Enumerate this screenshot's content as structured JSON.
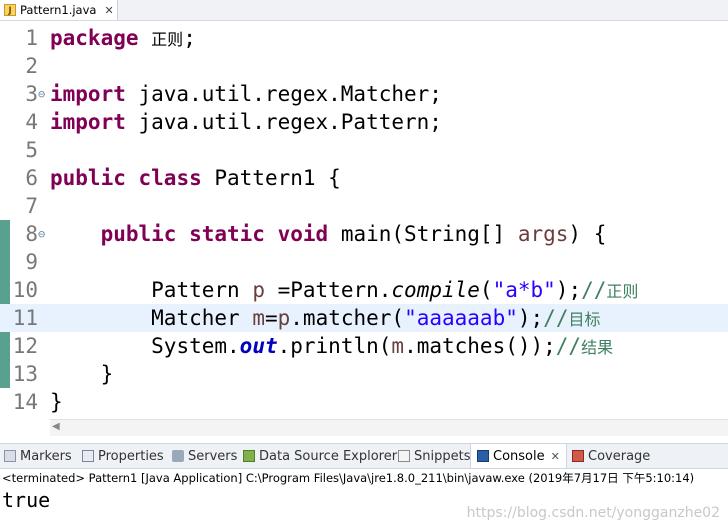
{
  "editor_tab": {
    "title": "Pattern1.java",
    "close": "✕"
  },
  "code_lines": [
    {
      "num": "1"
    },
    {
      "num": "2"
    },
    {
      "num": "3"
    },
    {
      "num": "4"
    },
    {
      "num": "5"
    },
    {
      "num": "6"
    },
    {
      "num": "7"
    },
    {
      "num": "8"
    },
    {
      "num": "9"
    },
    {
      "num": "10"
    },
    {
      "num": "11"
    },
    {
      "num": "12"
    },
    {
      "num": "13"
    },
    {
      "num": "14"
    }
  ],
  "code": {
    "l1_kw": "package",
    "l1_pkg": "正则",
    "l1_end": ";",
    "l3_kw": "import",
    "l3_rest": " java.util.regex.Matcher;",
    "l4_kw": "import",
    "l4_rest": " java.util.regex.Pattern;",
    "l6_kw1": "public",
    "l6_kw2": "class",
    "l6_rest": " Pattern1 {",
    "l8_kw1": "public",
    "l8_kw2": "static",
    "l8_kw3": "void",
    "l8_a": " main(String[] ",
    "l8_var": "args",
    "l8_b": ") {",
    "l10_a": "Pattern ",
    "l10_var": "p",
    "l10_b": " =Pattern.",
    "l10_m": "compile",
    "l10_c": "(",
    "l10_str": "\"a*b\"",
    "l10_d": ");",
    "l10_cmt": "//",
    "l10_cjk": "正则",
    "l11_a": "Matcher ",
    "l11_var": "m",
    "l11_b": "=",
    "l11_var2": "p",
    "l11_c": ".matcher(",
    "l11_str": "\"aaaaaab\"",
    "l11_d": ");",
    "l11_cmt": "//",
    "l11_cjk": "目标",
    "l12_a": "System.",
    "l12_fld": "out",
    "l12_b": ".println(",
    "l12_var": "m",
    "l12_c": ".matches());",
    "l12_cmt": "//",
    "l12_cjk": "结果",
    "l13": "}",
    "l14": "}"
  },
  "views_tabs": [
    {
      "label": "Markers",
      "icon": "markers-icon",
      "active": false
    },
    {
      "label": "Properties",
      "icon": "properties-icon",
      "active": false
    },
    {
      "label": "Servers",
      "icon": "servers-icon",
      "active": false
    },
    {
      "label": "Data Source Explorer",
      "icon": "data-source-icon",
      "active": false
    },
    {
      "label": "Snippets",
      "icon": "snippets-icon",
      "active": false
    },
    {
      "label": "Console",
      "icon": "console-icon",
      "active": true,
      "close": "✕"
    },
    {
      "label": "Coverage",
      "icon": "coverage-icon",
      "active": false
    }
  ],
  "console": {
    "status": "<terminated> Pattern1 [Java Application] C:\\Program Files\\Java\\jre1.8.0_211\\bin\\javaw.exe (2019年7月17日 下午5:10:14)",
    "output": "true"
  },
  "watermark": "https://blog.csdn.net/yongganzhe02"
}
